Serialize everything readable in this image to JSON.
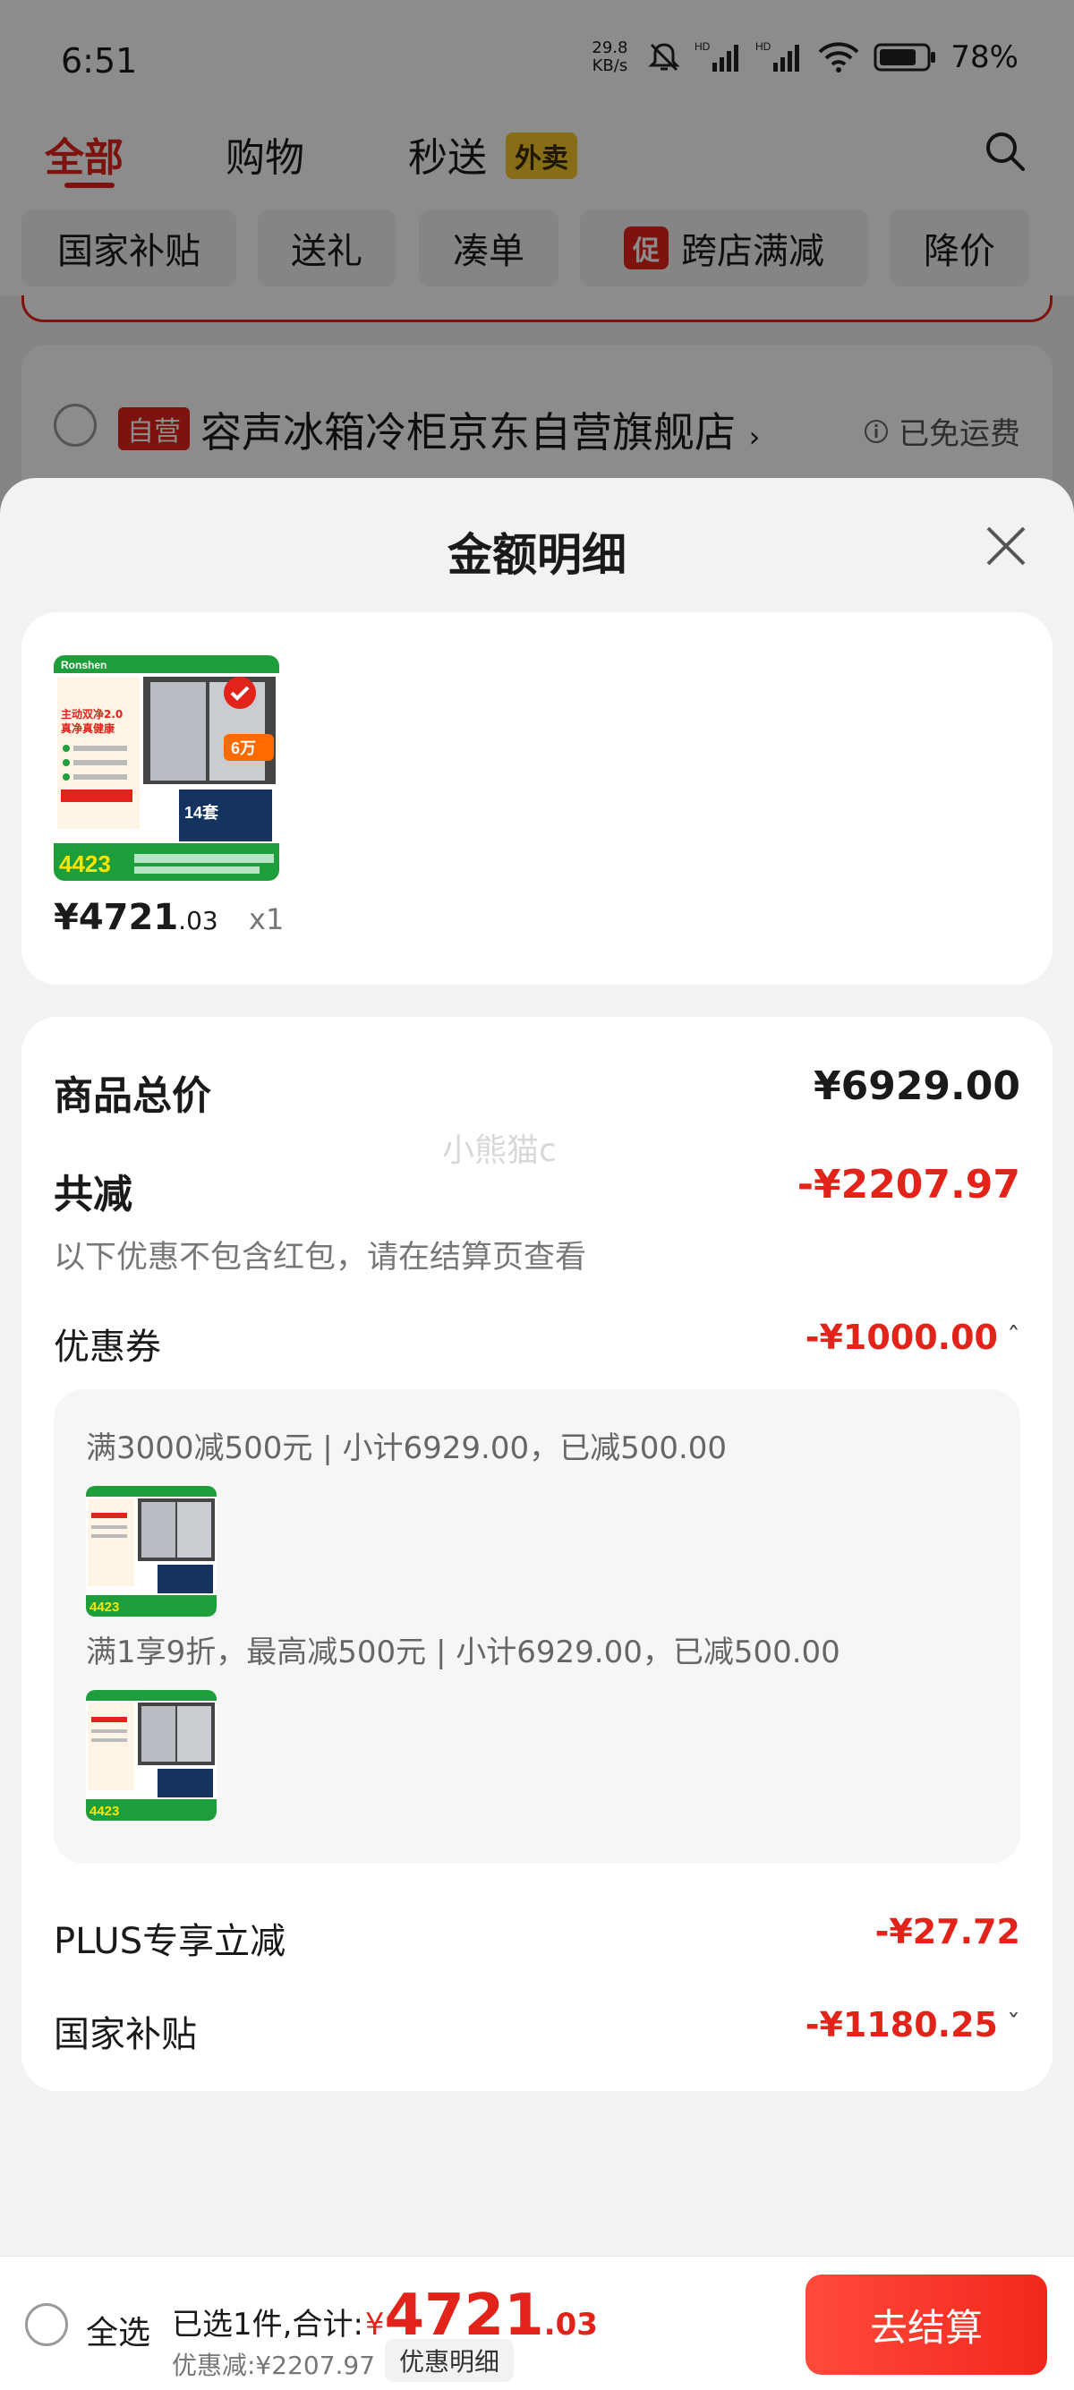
{
  "status_bar": {
    "time": "6:51",
    "speed_value": "29.8",
    "speed_unit": "KB/s",
    "hd1": "HD",
    "hd2": "HD",
    "battery": "78%"
  },
  "top_tabs": {
    "all": "全部",
    "shopping": "购物",
    "flash": "秒送",
    "takeout": "外卖"
  },
  "chips": [
    {
      "label": "国家补贴"
    },
    {
      "label": "送礼"
    },
    {
      "label": "凑单"
    },
    {
      "tag": "促",
      "label": "跨店满减"
    },
    {
      "label": "降价"
    }
  ],
  "store": {
    "tag": "自营",
    "name": "容声冰箱冷柜京东自营旗舰店",
    "chevron": "›",
    "shipping": "已免运费"
  },
  "sheet": {
    "title": "金额明细",
    "product": {
      "price_main": "¥4721",
      "price_cents": ".03",
      "qty": "x1"
    },
    "watermark": "小熊猫c",
    "total": {
      "label": "商品总价",
      "value": "¥6929.00"
    },
    "reduce": {
      "label": "共减",
      "value": "-¥2207.97",
      "note": "以下优惠不包含红包，请在结算页查看"
    },
    "coupon": {
      "label": "优惠券",
      "value": "-¥1000.00",
      "chevron": "ˆ"
    },
    "coupon_lines": [
      "满3000减500元 | 小计6929.00，已减500.00",
      "满1享9折，最高减500元 | 小计6929.00，已减500.00"
    ],
    "plus": {
      "label": "PLUS专享立减",
      "value": "-¥27.72"
    },
    "subsidy": {
      "label": "国家补贴",
      "value": "-¥1180.25",
      "chevron": "ˇ"
    }
  },
  "bottom": {
    "select_all": "全选",
    "summary_prefix": "已选1件,合计:",
    "yen": "¥",
    "amount_main": "4721",
    "amount_cents": ".03",
    "discount": "优惠减:¥2207.97",
    "detail_pill": "优惠明细",
    "checkout": "去结算"
  },
  "product_image_text": {
    "brand": "Ronshen",
    "headline": "主动双净2.0",
    "sub": "真净真健康",
    "price": "4423",
    "badge": "14套",
    "figure": "6万"
  },
  "colors": {
    "accent": "#e2231a",
    "takeout_badge": "#f7c62a",
    "image_green": "#1e9e3a"
  }
}
